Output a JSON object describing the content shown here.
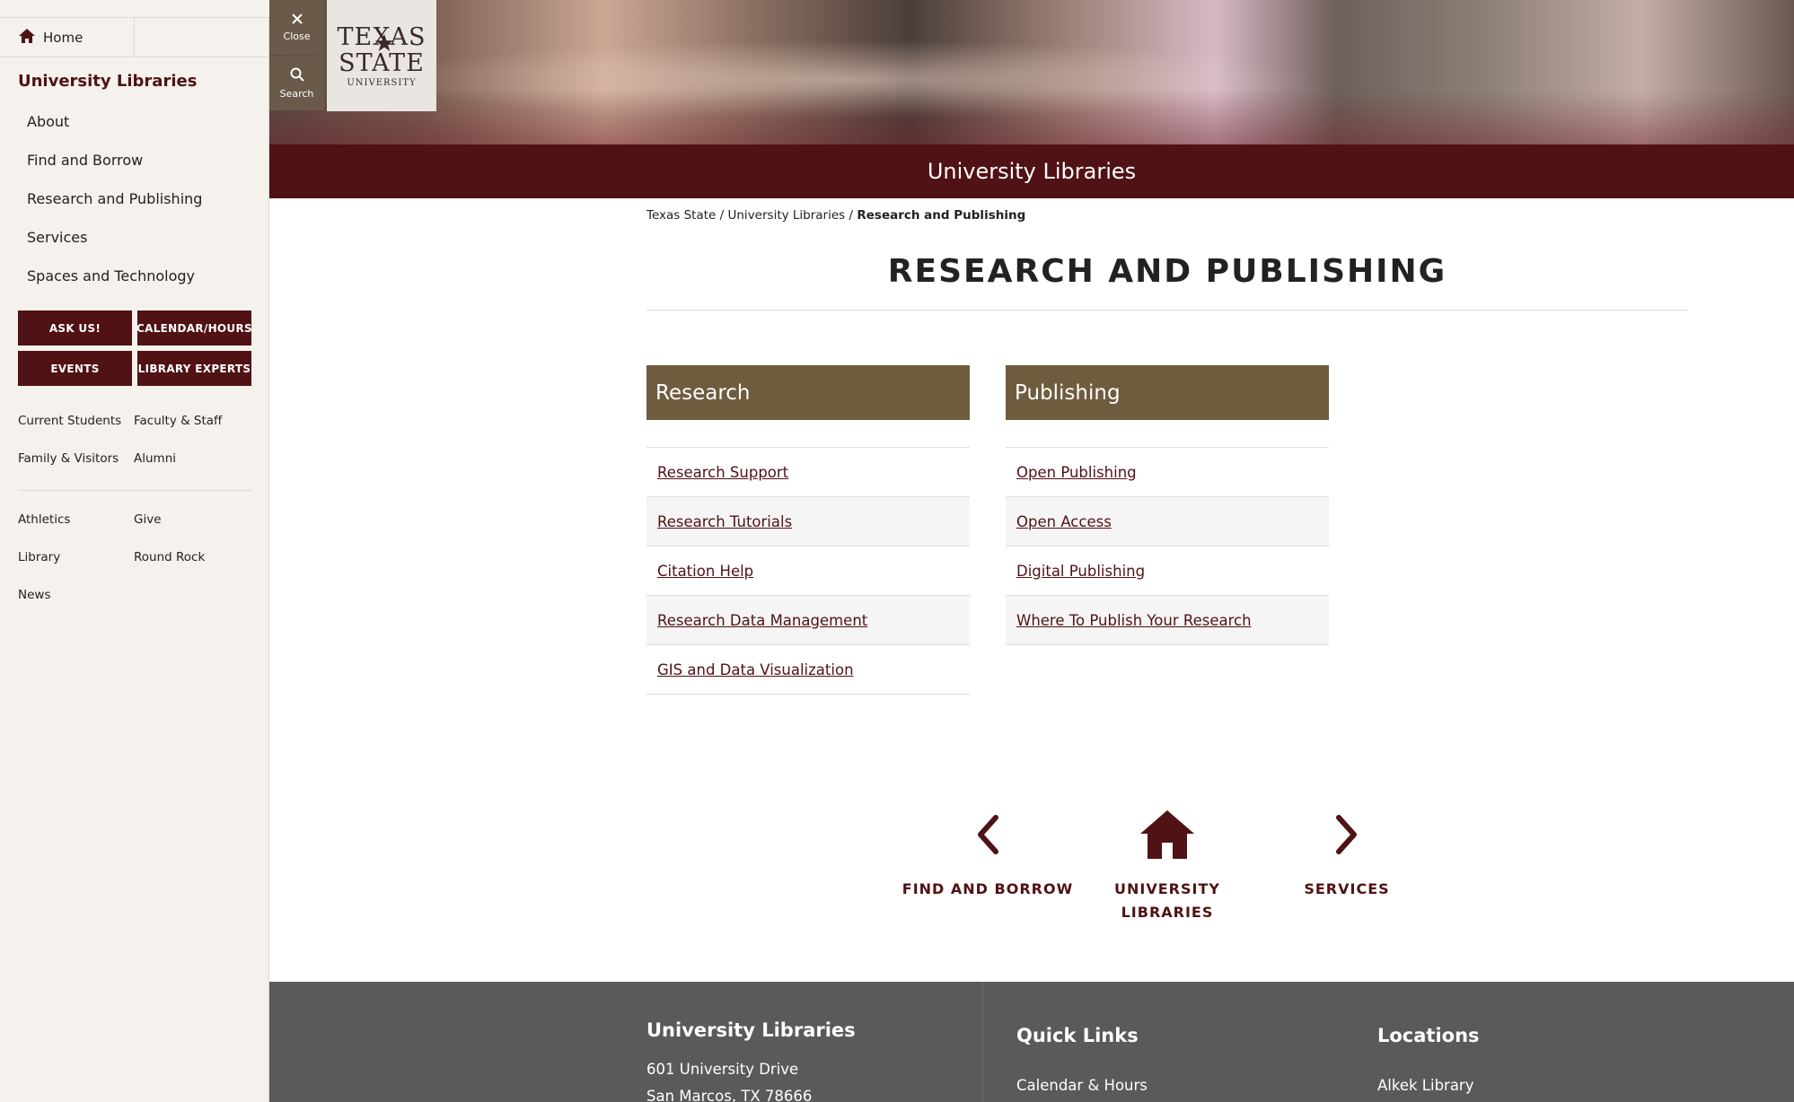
{
  "sidebar": {
    "home_label": "Home",
    "title": "University Libraries",
    "nav": [
      "About",
      "Find and Borrow",
      "Research and Publishing",
      "Services",
      "Spaces and Technology"
    ],
    "buttons": [
      "ASK US!",
      "CALENDAR/HOURS",
      "EVENTS",
      "LIBRARY EXPERTS"
    ],
    "audience_links": [
      "Current Students",
      "Faculty & Staff",
      "Family & Visitors",
      "Alumni"
    ],
    "other_links": [
      "Athletics",
      "Give",
      "Library",
      "Round Rock",
      "News"
    ]
  },
  "header": {
    "close_label": "Close",
    "search_label": "Search",
    "logo": {
      "line1": "TEXAS",
      "line2": "STATE",
      "line3": "UNIVERSITY"
    },
    "banner_title": "University Libraries"
  },
  "breadcrumb": {
    "items": [
      "Texas State",
      "University Libraries"
    ],
    "current": "Research and Publishing",
    "separator": "/"
  },
  "page": {
    "title": "RESEARCH AND PUBLISHING"
  },
  "cards": [
    {
      "title": "Research",
      "links": [
        "Research Support",
        "Research Tutorials",
        "Citation Help",
        "Research Data Management",
        "GIS and Data Visualization"
      ]
    },
    {
      "title": "Publishing",
      "links": [
        "Open Publishing",
        "Open Access",
        "Digital Publishing",
        "Where To Publish Your Research"
      ]
    }
  ],
  "pager": {
    "prev_label": "FIND AND BORROW",
    "home_label_1": "UNIVERSITY",
    "home_label_2": "LIBRARIES",
    "next_label": "SERVICES"
  },
  "footer": {
    "col1": {
      "title": "University Libraries",
      "address1": "601 University Drive",
      "address2": "San Marcos, TX 78666"
    },
    "col2": {
      "title": "Quick Links",
      "item1": "Calendar & Hours"
    },
    "col3": {
      "title": "Locations",
      "item1": "Alkek Library"
    }
  },
  "colors": {
    "maroon": "#501214",
    "gold_brown": "#6f5b3e",
    "footer_gray": "#5a5a5a"
  }
}
